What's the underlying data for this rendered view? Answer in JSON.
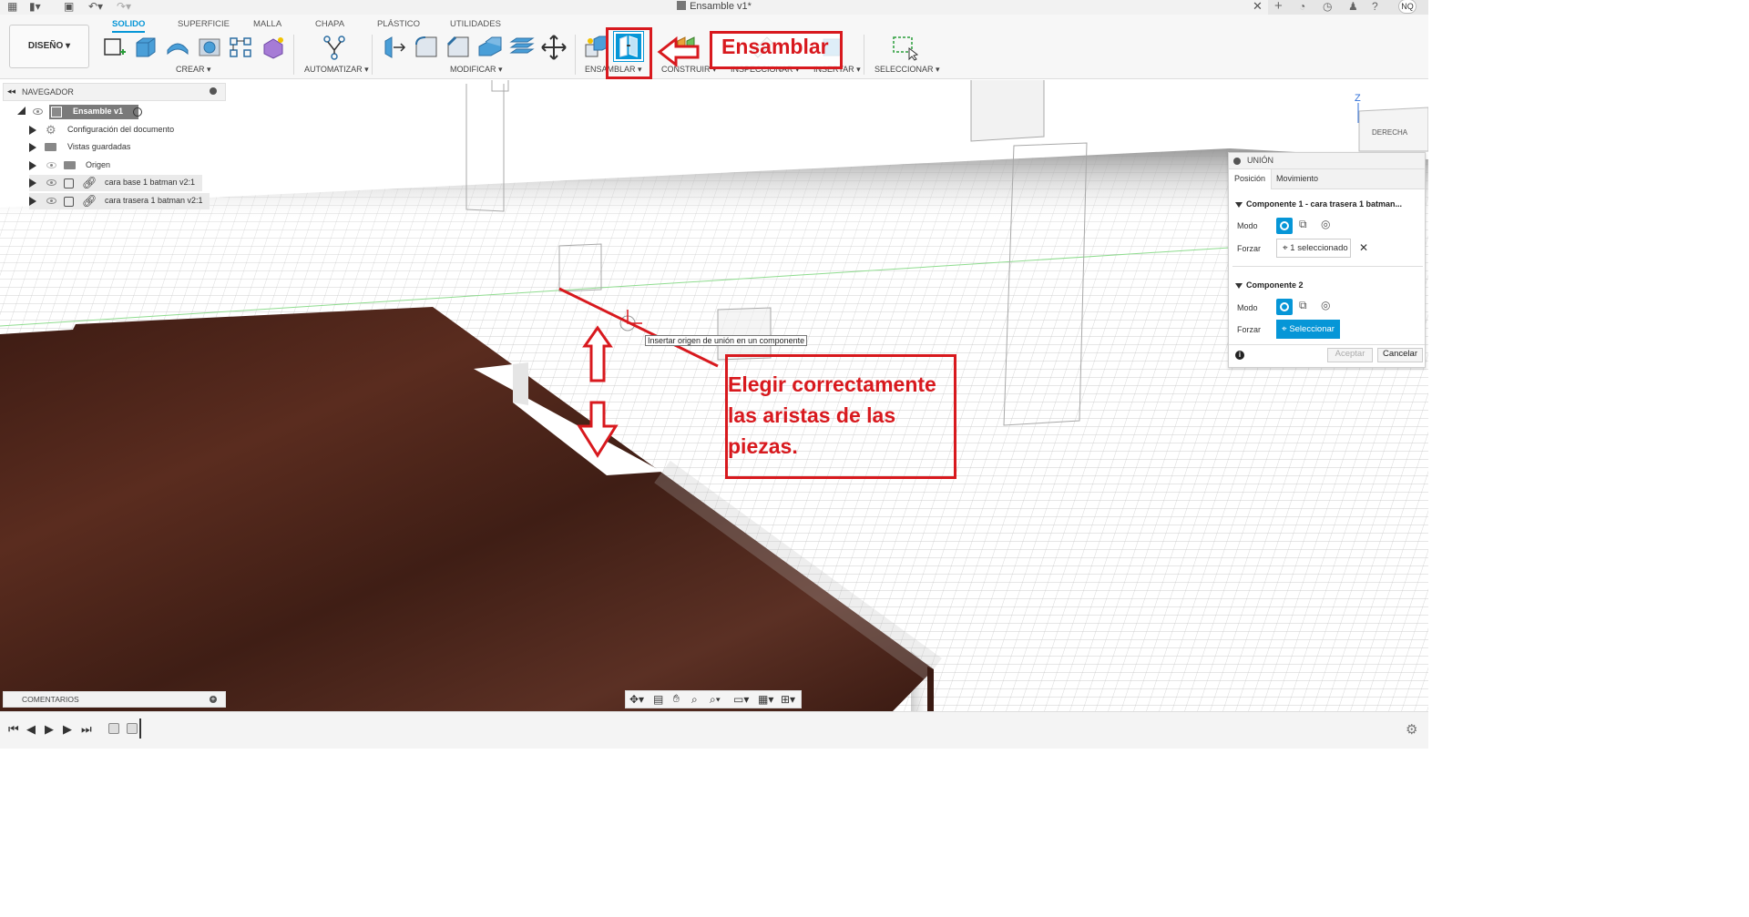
{
  "window": {
    "title": "Ensamble v1*",
    "user_initials": "NQ"
  },
  "tabs": [
    {
      "label": "SOLIDO"
    },
    {
      "label": "SUPERFICIE"
    },
    {
      "label": "MALLA"
    },
    {
      "label": "CHAPA"
    },
    {
      "label": "PLÁSTICO"
    },
    {
      "label": "UTILIDADES"
    }
  ],
  "workspace": {
    "label": "DISEÑO ▾"
  },
  "groups": {
    "crear": "CREAR ▾",
    "automatizar": "AUTOMATIZAR ▾",
    "modificar": "MODIFICAR ▾",
    "ensamblar": "ENSAMBLAR ▾",
    "construir": "CONSTRUIR ▾",
    "inspeccionar": "INSPECCIONAR ▾",
    "insertar": "INSERTAR ▾",
    "seleccionar": "SELECCIONAR ▾"
  },
  "navigator": {
    "title": "NAVEGADOR",
    "root": "Ensamble v1",
    "items": [
      {
        "label": "Configuración del documento"
      },
      {
        "label": "Vistas guardadas"
      },
      {
        "label": "Origen"
      },
      {
        "label": "cara base 1 batman v2:1"
      },
      {
        "label": "cara trasera 1 batman v2:1"
      }
    ]
  },
  "view_cube": {
    "axis_label": "Z",
    "face_label": "DERECHA"
  },
  "union_panel": {
    "title": "UNIÓN",
    "tab_position": "Posición",
    "tab_motion": "Movimiento",
    "comp1_title": "Componente 1 - cara trasera 1 batman...",
    "comp1_mode_label": "Modo",
    "comp1_force_label": "Forzar",
    "comp1_selection": "1 seleccionado",
    "comp2_title": "Componente 2",
    "comp2_mode_label": "Modo",
    "comp2_force_label": "Forzar",
    "comp2_selection": "Seleccionar",
    "accept": "Aceptar",
    "cancel": "Cancelar"
  },
  "tooltip": "Insertar origen de unión en un componente",
  "comments": {
    "label": "COMENTARIOS"
  },
  "annotations": {
    "ensamblar": "Ensamblar",
    "elegir_lines": [
      "Elegir correctamente",
      "las aristas de las",
      "piezas."
    ]
  },
  "colors": {
    "accent": "#0696d7",
    "annotation": "#d8191e",
    "wood": "#4a2419"
  }
}
